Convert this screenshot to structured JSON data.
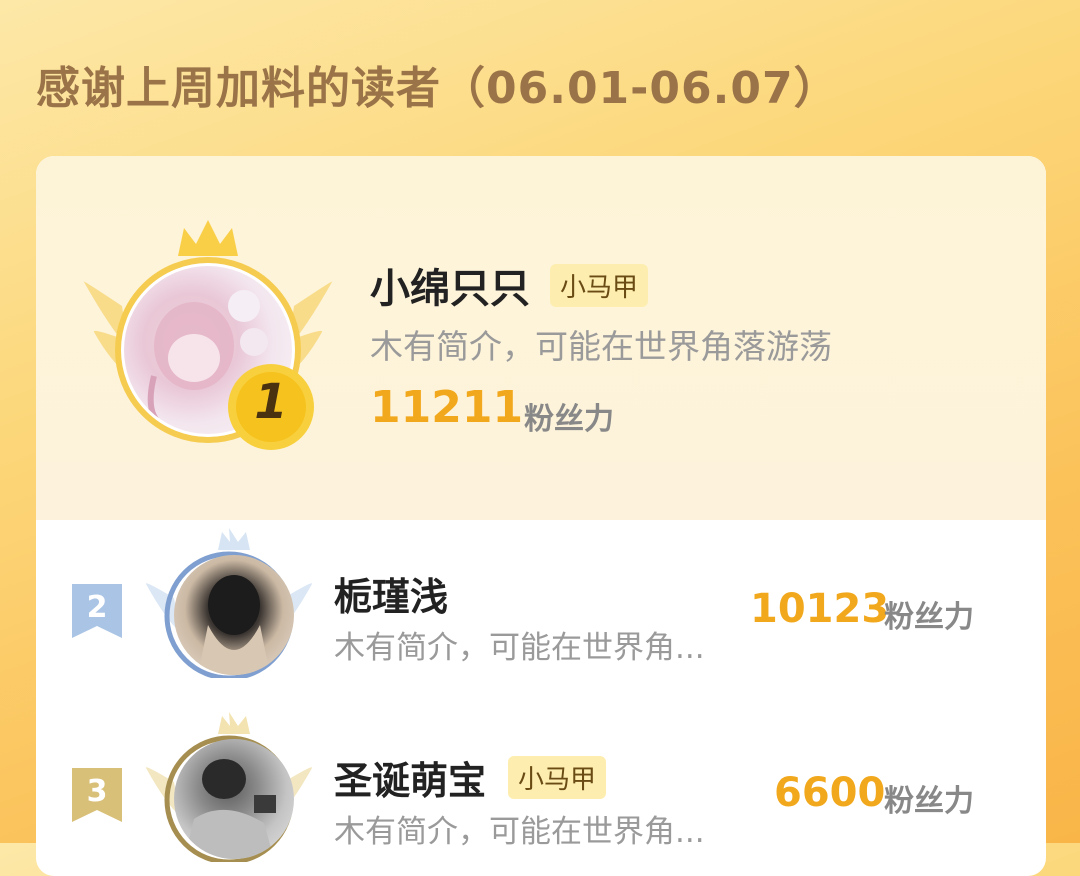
{
  "header": {
    "title": "感谢上周加料的读者（06.01-06.07）"
  },
  "readers": [
    {
      "rank": "1",
      "name": "小绵只只",
      "tag": "小马甲",
      "bio": "木有简介，可能在世界角落游荡",
      "fans": "11211",
      "fans_unit": "粉丝力"
    },
    {
      "rank": "2",
      "name": "栀瑾浅",
      "tag": "",
      "bio": "木有简介，可能在世界角...",
      "fans": "10123",
      "fans_unit": "粉丝力"
    },
    {
      "rank": "3",
      "name": "圣诞萌宝",
      "tag": "小马甲",
      "bio": "木有简介，可能在世界角...",
      "fans": "6600",
      "fans_unit": "粉丝力"
    }
  ],
  "colors": {
    "gold": "#f2a81c",
    "silver": "#a9c4e4",
    "bronze": "#d9c079",
    "title": "#9a7448"
  },
  "icons": {
    "crown": "crown-icon",
    "wings": "wings-icon",
    "rank_medal": "rank-medal-icon",
    "rank_flag": "rank-flag-icon"
  }
}
